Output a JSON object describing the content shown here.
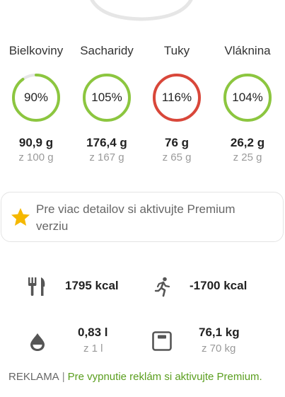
{
  "macros": [
    {
      "name": "Bielkoviny",
      "percent": "90%",
      "fraction": 0.9,
      "amount": "90,9 g",
      "goal": "z 100 g",
      "color": "#8cc63f"
    },
    {
      "name": "Sacharidy",
      "percent": "105%",
      "fraction": 1.05,
      "amount": "176,4 g",
      "goal": "z 167 g",
      "color": "#8cc63f"
    },
    {
      "name": "Tuky",
      "percent": "116%",
      "fraction": 1.16,
      "amount": "76 g",
      "goal": "z 65 g",
      "color": "#d9473a"
    },
    {
      "name": "Vláknina",
      "percent": "104%",
      "fraction": 1.04,
      "amount": "26,2 g",
      "goal": "z 25 g",
      "color": "#8cc63f"
    }
  ],
  "premium": {
    "text": "Pre viac detailov si aktivujte Premium verziu",
    "icon": "star-icon",
    "icon_color": "#f5b800"
  },
  "stats": {
    "food": {
      "icon": "fork-knife-icon",
      "value": "1795 kcal"
    },
    "exercise": {
      "icon": "running-person-icon",
      "value": "-1700 kcal"
    },
    "water": {
      "icon": "water-drop-icon",
      "value": "0,83 l",
      "goal": "z 1 l"
    },
    "weight": {
      "icon": "scale-icon",
      "value": "76,1 kg",
      "goal": "z 70 kg"
    }
  },
  "ad": {
    "label": "REKLAMA",
    "separator": "|",
    "link": "Pre vypnutie reklám si aktivujte Premium."
  },
  "colors": {
    "accent_green": "#8cc63f",
    "over_red": "#d9473a",
    "ring_track": "#e6e6e6",
    "icon_gray": "#555555",
    "link_green": "#5a9e1e"
  }
}
